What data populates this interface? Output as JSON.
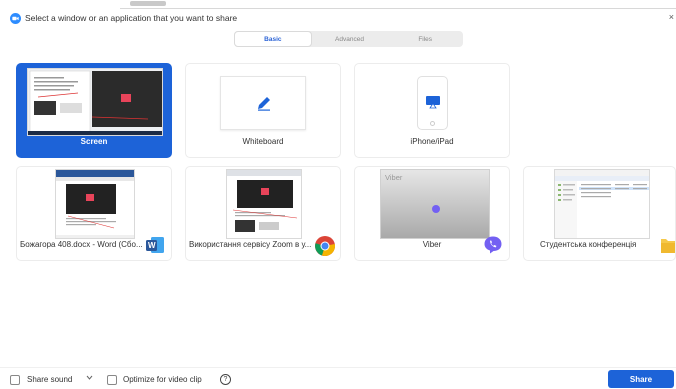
{
  "window": {
    "title": "Select a window or an application that you want to share",
    "close_glyph": "×"
  },
  "tabs": [
    {
      "label": "Basic",
      "active": true
    },
    {
      "label": "Advanced",
      "active": false
    },
    {
      "label": "Files",
      "active": false
    }
  ],
  "tiles": {
    "screen": {
      "label": "Screen",
      "selected": true
    },
    "whiteboard": {
      "label": "Whiteboard",
      "icon": "pencil-icon"
    },
    "iphone": {
      "label": "iPhone/iPad",
      "icon": "airplay-icon"
    },
    "word": {
      "label": "Божагора 408.docx - Word (Сбо...",
      "icon": "word-app-icon",
      "icon_letter": "W"
    },
    "chrome": {
      "label": "Використання сервісу Zoom в у...",
      "icon": "chrome-app-icon"
    },
    "viber": {
      "label": "Viber",
      "thumb_text": "Viber",
      "icon": "viber-app-icon"
    },
    "folder": {
      "label": "Студентська конференція",
      "icon": "folder-icon"
    }
  },
  "bottom": {
    "share_sound": "Share sound",
    "optimize": "Optimize for video clip",
    "help_glyph": "?",
    "share_button": "Share"
  },
  "colors": {
    "accent": "#1d63d8",
    "zoom_blue": "#2d8cff",
    "viber_purple": "#7360f2",
    "word_blue": "#2b579a",
    "folder_yellow": "#f6c94a"
  }
}
